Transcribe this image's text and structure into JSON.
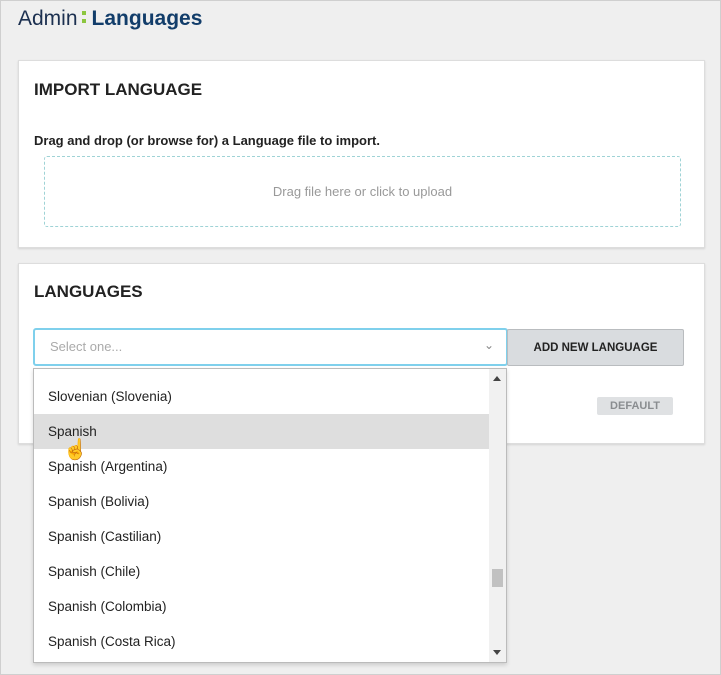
{
  "header": {
    "prefix": "Admin",
    "title": "Languages",
    "colon_colors": [
      "#8cc63f",
      "#1fa3d6"
    ]
  },
  "import": {
    "heading": "IMPORT LANGUAGE",
    "instructions": "Drag and drop (or browse for) a Language file to import.",
    "dropzone": "Drag file here or click to upload"
  },
  "languages": {
    "heading": "LANGUAGES",
    "select_placeholder": "Select one...",
    "add_button": "ADD NEW LANGUAGE",
    "default_badge": "DEFAULT",
    "options": [
      "Slovenian (Slovenia)",
      "Spanish",
      "Spanish (Argentina)",
      "Spanish (Bolivia)",
      "Spanish (Castilian)",
      "Spanish (Chile)",
      "Spanish (Colombia)",
      "Spanish (Costa Rica)"
    ],
    "highlighted": "Spanish"
  }
}
